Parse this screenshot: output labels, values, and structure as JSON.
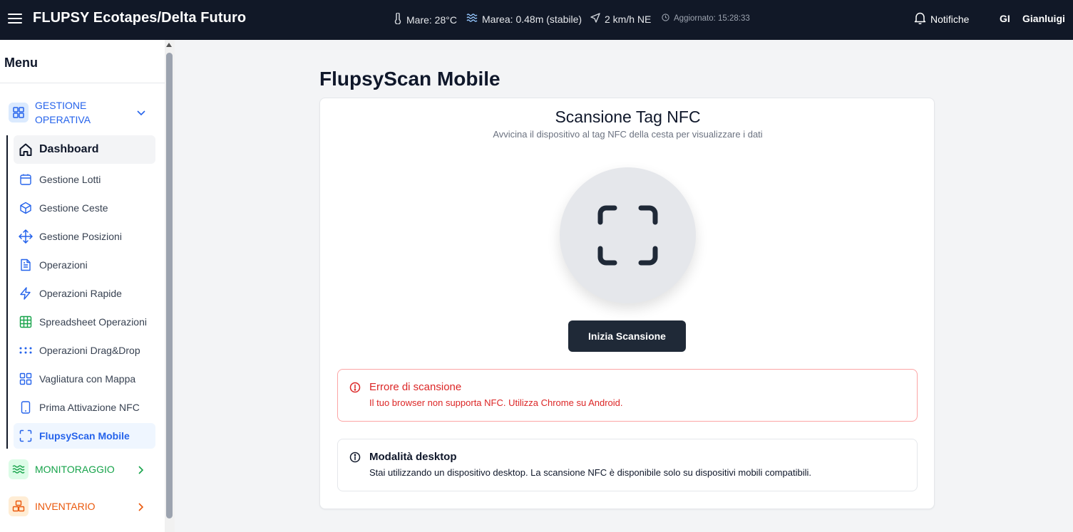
{
  "header": {
    "title": "FLUPSY Ecotapes/Delta Futuro",
    "sea_temp": "Mare: 28°C",
    "tide": "Marea: 0.48m (stabile)",
    "wind": "2 km/h NE",
    "updated": "Aggiornato: 15:28:33",
    "notifications": "Notifiche",
    "user_initials": "GI",
    "user_name": "Gianluigi"
  },
  "sidebar": {
    "menu_title": "Menu",
    "groups": [
      {
        "label": "GESTIONE OPERATIVA",
        "color": "#2563eb",
        "expanded": true
      },
      {
        "label": "MONITORAGGIO",
        "color": "#16a34a",
        "expanded": false
      },
      {
        "label": "INVENTARIO",
        "color": "#ea580c",
        "expanded": false
      }
    ],
    "items": [
      {
        "label": "Dashboard",
        "icon": "home-icon"
      },
      {
        "label": "Gestione Lotti",
        "icon": "calendar-box-icon"
      },
      {
        "label": "Gestione Ceste",
        "icon": "cube-icon"
      },
      {
        "label": "Gestione Posizioni",
        "icon": "move-icon"
      },
      {
        "label": "Operazioni",
        "icon": "file-text-icon"
      },
      {
        "label": "Operazioni Rapide",
        "icon": "lightning-icon"
      },
      {
        "label": "Spreadsheet Operazioni",
        "icon": "table-icon"
      },
      {
        "label": "Operazioni Drag&Drop",
        "icon": "dots-grid-icon"
      },
      {
        "label": "Vagliatura con Mappa",
        "icon": "layout-grid-icon"
      },
      {
        "label": "Prima Attivazione NFC",
        "icon": "smartphone-icon"
      },
      {
        "label": "FlupsyScan Mobile",
        "icon": "scan-icon",
        "active": true
      }
    ]
  },
  "main": {
    "page_title": "FlupsyScan Mobile",
    "card_title": "Scansione Tag NFC",
    "card_subtitle": "Avvicina il dispositivo al tag NFC della cesta per visualizzare i dati",
    "scan_button": "Inizia Scansione",
    "error_title": "Errore di scansione",
    "error_text": "Il tuo browser non supporta NFC. Utilizza Chrome su Android.",
    "info_title": "Modalità desktop",
    "info_text": "Stai utilizzando un dispositivo desktop. La scansione NFC è disponibile solo su dispositivi mobili compatibili."
  },
  "colors": {
    "header_bg": "#111827",
    "accent_blue": "#2563eb",
    "error_red": "#dc2626",
    "button_dark": "#1f2937"
  }
}
